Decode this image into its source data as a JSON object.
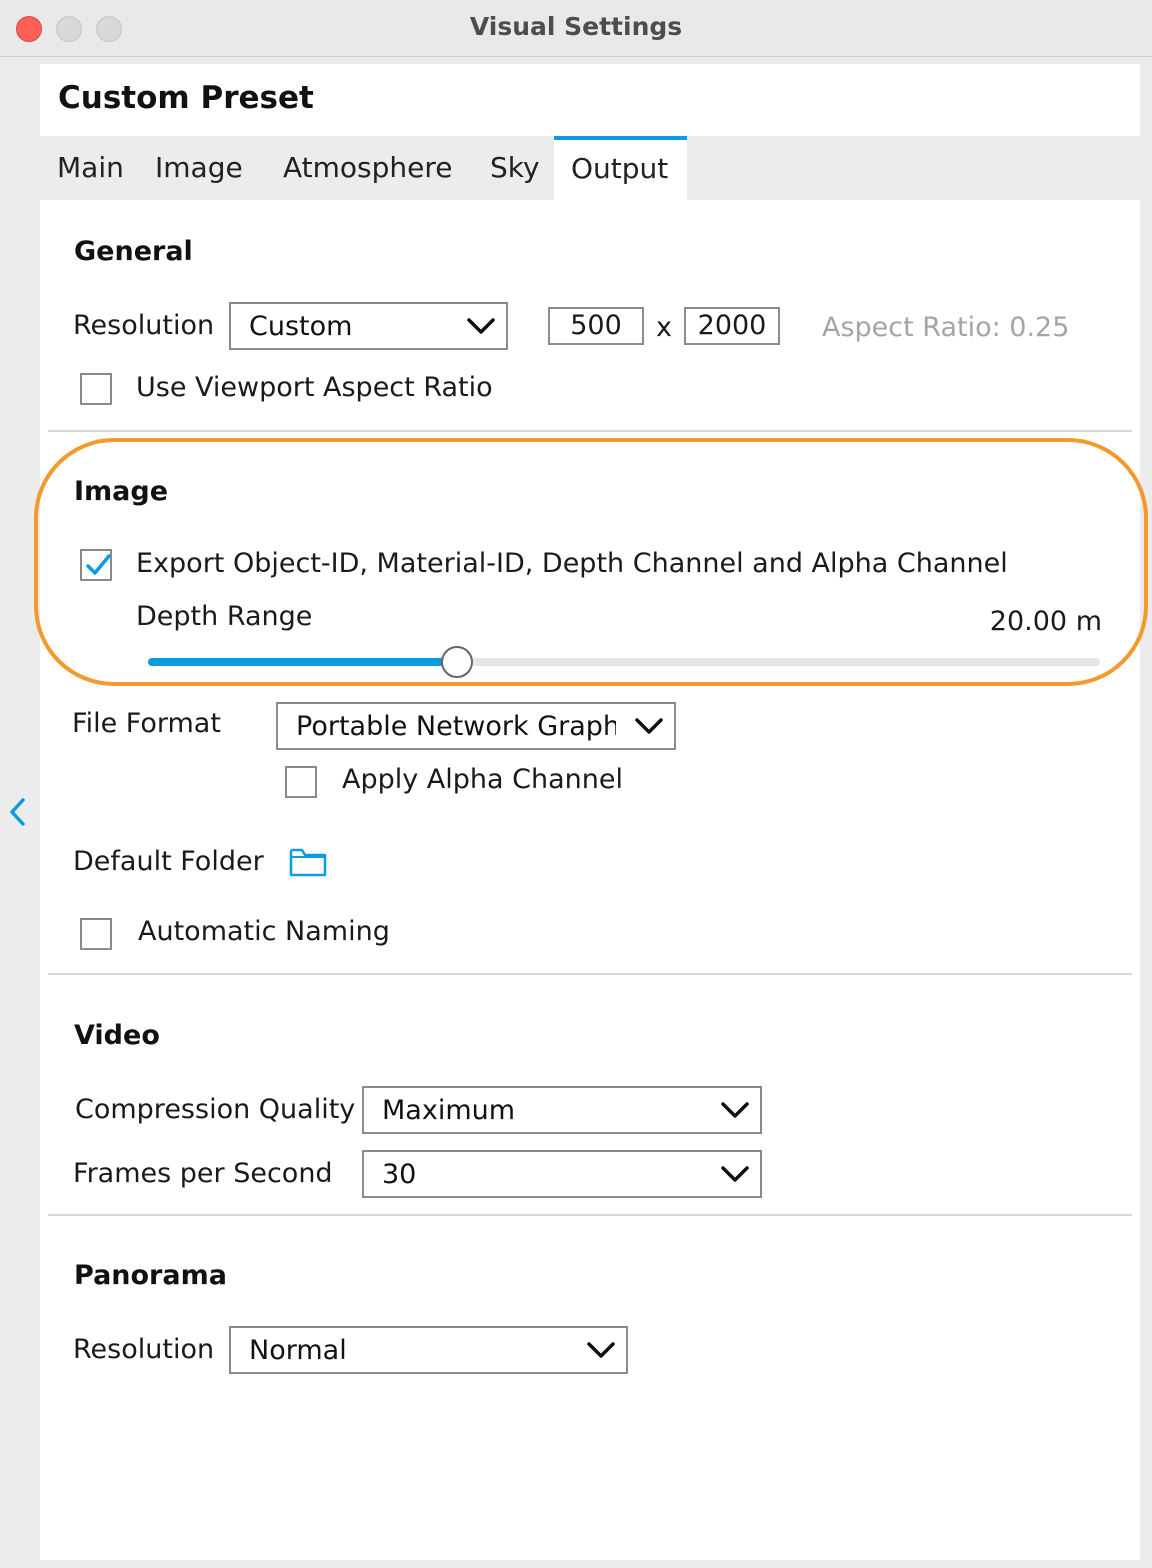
{
  "window": {
    "title": "Visual Settings"
  },
  "panel": {
    "preset_title": "Custom Preset",
    "tabs": [
      {
        "label": "Main",
        "active": false
      },
      {
        "label": "Image",
        "active": false
      },
      {
        "label": "Atmosphere",
        "active": false
      },
      {
        "label": "Sky",
        "active": false
      },
      {
        "label": "Output",
        "active": true
      }
    ]
  },
  "general": {
    "heading": "General",
    "resolution_label": "Resolution",
    "resolution_value": "Custom",
    "width": "500",
    "times": "x",
    "height": "2000",
    "aspect_ratio": "Aspect Ratio: 0.25",
    "use_viewport_label": "Use Viewport Aspect Ratio",
    "use_viewport_checked": false
  },
  "image": {
    "heading": "Image",
    "export_label": "Export Object-ID, Material-ID, Depth Channel and Alpha Channel",
    "export_checked": true,
    "depth_label": "Depth Range",
    "depth_value": "20.00",
    "depth_unit": "m",
    "depth_slider_fraction": 0.325,
    "file_format_label": "File Format",
    "file_format_value": "Portable Network Graphics",
    "apply_alpha_label": "Apply Alpha Channel",
    "apply_alpha_checked": false,
    "default_folder_label": "Default Folder",
    "automatic_naming_label": "Automatic Naming",
    "automatic_naming_checked": false
  },
  "video": {
    "heading": "Video",
    "compression_label": "Compression Quality",
    "compression_value": "Maximum",
    "fps_label": "Frames per Second",
    "fps_value": "30"
  },
  "panorama": {
    "heading": "Panorama",
    "resolution_label": "Resolution",
    "resolution_value": "Normal"
  },
  "colors": {
    "accent": "#0a9be0",
    "highlight": "#f29a2e",
    "close": "#fe5f57"
  },
  "icons": {
    "collapse": "chevron-left-icon",
    "folder": "folder-icon",
    "dropdown": "chevron-down-icon",
    "check": "checkmark-icon"
  }
}
